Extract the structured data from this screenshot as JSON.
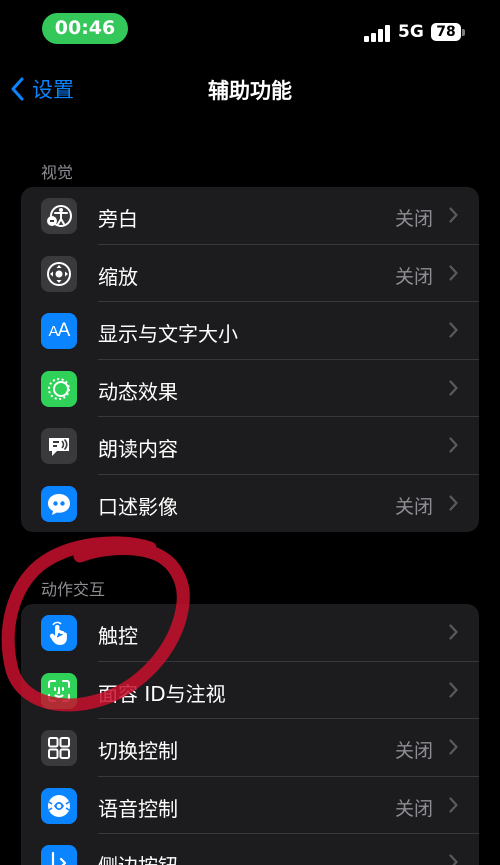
{
  "status": {
    "time": "00:46",
    "network": "5G",
    "battery": "78"
  },
  "nav": {
    "back_label": "设置",
    "title": "辅助功能"
  },
  "sections": {
    "vision": {
      "header": "视觉",
      "items": [
        {
          "label": "旁白",
          "value": "关闭",
          "icon": "voiceover-icon"
        },
        {
          "label": "缩放",
          "value": "关闭",
          "icon": "zoom-icon"
        },
        {
          "label": "显示与文字大小",
          "value": "",
          "icon": "text-size-icon"
        },
        {
          "label": "动态效果",
          "value": "",
          "icon": "motion-icon"
        },
        {
          "label": "朗读内容",
          "value": "",
          "icon": "spoken-content-icon"
        },
        {
          "label": "口述影像",
          "value": "关闭",
          "icon": "audio-description-icon"
        }
      ]
    },
    "interaction": {
      "header": "动作交互",
      "items": [
        {
          "label": "触控",
          "value": "",
          "icon": "touch-icon"
        },
        {
          "label": "面容 ID与注视",
          "value": "",
          "icon": "face-id-icon"
        },
        {
          "label": "切换控制",
          "value": "关闭",
          "icon": "switch-control-icon"
        },
        {
          "label": "语音控制",
          "value": "关闭",
          "icon": "voice-control-icon"
        },
        {
          "label": "侧边按钮",
          "value": "",
          "icon": "side-button-icon"
        }
      ]
    }
  },
  "colors": {
    "accent": "#0a84ff",
    "green": "#34c759",
    "annotation": "#c8102e"
  }
}
